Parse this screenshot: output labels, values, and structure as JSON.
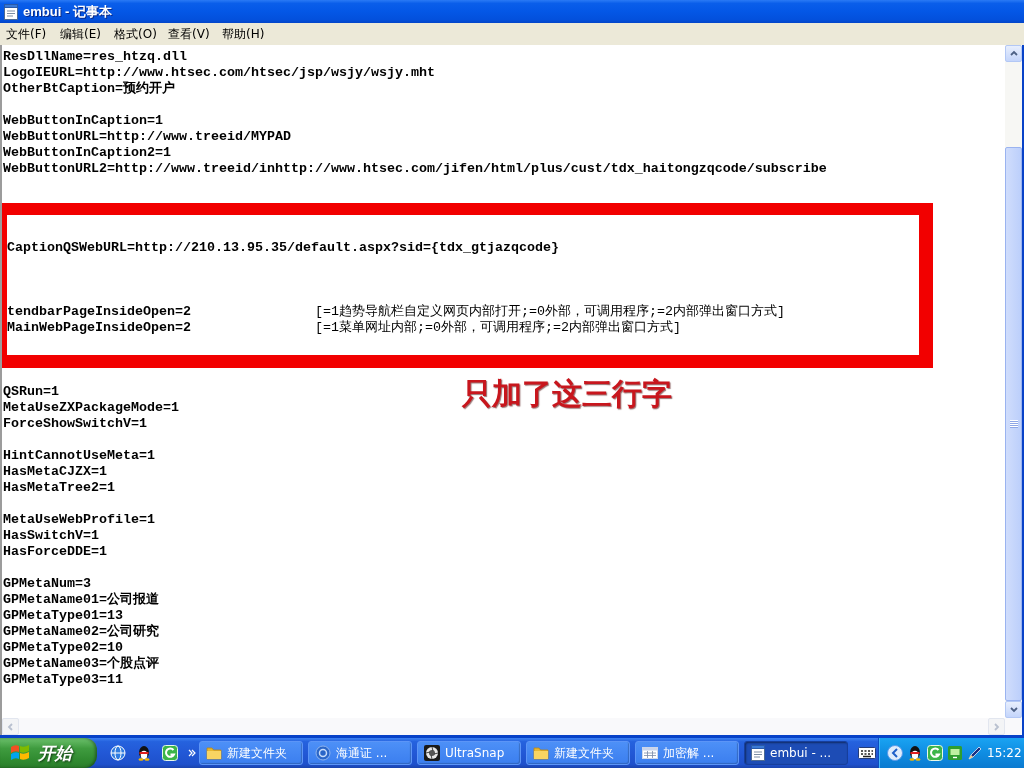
{
  "window": {
    "title": "embui - 记事本"
  },
  "menu_bar": [
    {
      "label": "文件(F)"
    },
    {
      "label": "编辑(E)"
    },
    {
      "label": "格式(O)"
    },
    {
      "label": "查看(V)"
    },
    {
      "label": "帮助(H)"
    }
  ],
  "editor": {
    "blocks": [
      {
        "kind": "plain",
        "lines": [
          {
            "text": "ResDllName=res_htzq.dll"
          },
          {
            "text": "LogoIEURL=http://www.htsec.com/htsec/jsp/wsjy/wsjy.mht"
          },
          {
            "text": "OtherBtCaption=预约开户"
          }
        ]
      },
      {
        "kind": "plain",
        "lines": [
          {
            "text": "WebButtonInCaption=1"
          },
          {
            "text": "WebButtonURL=http://www.treeid/MYPAD"
          },
          {
            "text": "WebButtonInCaption2=1"
          },
          {
            "text": "WebButtonURL2=http://www.treeid/inhttp://www.htsec.com/jifen/html/plus/cust/tdx_haitongzqcode/subscribe"
          }
        ]
      },
      {
        "kind": "highlighted",
        "groups": [
          {
            "lines": [
              {
                "text": "CaptionQSWebURL=http://210.13.95.35/default.aspx?sid={tdx_gtjazqcode}"
              }
            ]
          },
          {
            "lines": [
              {
                "text": "tendbarPageInsideOpen=2",
                "comment": "[=1趋势导航栏自定义网页内部打开;=0外部，可调用程序;=2内部弹出窗口方式]"
              },
              {
                "text": "MainWebPageInsideOpen=2",
                "comment": "[=1菜单网址内部;=0外部，可调用程序;=2内部弹出窗口方式]"
              }
            ]
          }
        ]
      },
      {
        "kind": "plain",
        "lines": [
          {
            "text": "QSRun=1"
          },
          {
            "text": "MetaUseZXPackageMode=1"
          },
          {
            "text": "ForceShowSwitchV=1"
          }
        ]
      },
      {
        "kind": "plain",
        "lines": [
          {
            "text": "HintCannotUseMeta=1"
          },
          {
            "text": "HasMetaCJZX=1"
          },
          {
            "text": "HasMetaTree2=1"
          }
        ]
      },
      {
        "kind": "plain",
        "lines": [
          {
            "text": "MetaUseWebProfile=1"
          },
          {
            "text": "HasSwitchV=1"
          },
          {
            "text": "HasForceDDE=1"
          }
        ]
      },
      {
        "kind": "plain",
        "lines": [
          {
            "text": "GPMetaNum=3"
          },
          {
            "text": "GPMetaName01=公司报道"
          },
          {
            "text": "GPMetaType01=13"
          },
          {
            "text": "GPMetaName02=公司研究"
          },
          {
            "text": "GPMetaType02=10"
          },
          {
            "text": "GPMetaName03=个股点评"
          },
          {
            "text": "GPMetaType03=11"
          }
        ]
      }
    ]
  },
  "annotation": {
    "text": "只加了这三行字"
  },
  "taskbar": {
    "start_button": {
      "label": "开始"
    },
    "tasks": [
      {
        "kind": "folder",
        "label": "新建文件夹",
        "selected": false
      },
      {
        "kind": "disc",
        "label": "海通证 ...",
        "selected": false
      },
      {
        "kind": "aperture",
        "label": "UltraSnap",
        "selected": false
      },
      {
        "kind": "folder",
        "label": "新建文件夹",
        "selected": false
      },
      {
        "kind": "window",
        "label": "加密解 ...",
        "selected": false
      },
      {
        "kind": "notepad",
        "label": "embui - ...",
        "selected": true
      }
    ],
    "clock": "15:22"
  }
}
